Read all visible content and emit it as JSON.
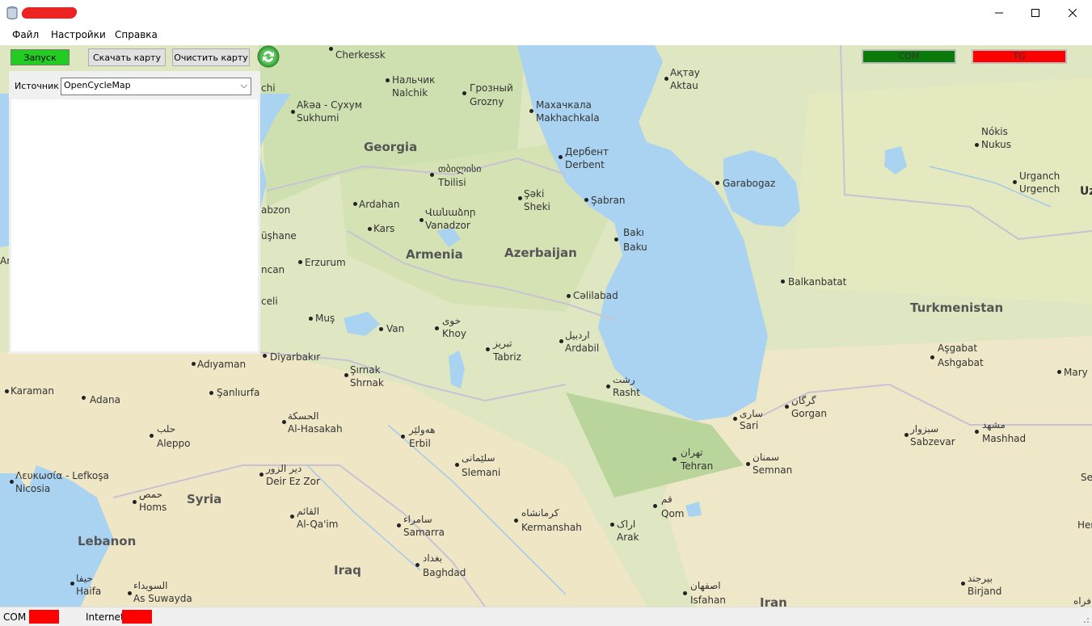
{
  "window": {
    "title_redacted": true
  },
  "menu": [
    "Файл",
    "Настройки",
    "Справка"
  ],
  "toolbar": {
    "start_label": "Запуск",
    "start_color": "#22cc22",
    "download_label": "Скачать карту",
    "clear_label": "Очистить карту",
    "refresh_icon": "refresh-icon"
  },
  "source": {
    "label": "Источник",
    "value": "OpenCycleMap"
  },
  "indicators": {
    "com": {
      "label": "COM",
      "color": "#0a7a0a"
    },
    "tg": {
      "label": "TG",
      "color": "#ff0000"
    }
  },
  "status": {
    "com_label": "COM",
    "internet_label": "Internet",
    "color": "#ff0000"
  },
  "map": {
    "countries": [
      "Georgia",
      "Armenia",
      "Azerbaijan",
      "Turkmenistan",
      "Syria",
      "Lebanon",
      "Iraq",
      "Iran"
    ],
    "cities": [
      "Cherkessk",
      "Нальчик",
      "Nalchik",
      "Грозный",
      "Grozny",
      "Махачкала",
      "Makhachkala",
      "Ақтау",
      "Aktau",
      "Аҟәа - Сухум",
      "Sukhumi",
      "chi",
      "Дербент",
      "Derbent",
      "Nókis",
      "Nukus",
      "თბილისი",
      "Tbilisi",
      "Garabogaz",
      "Urganch",
      "Urgench",
      "Şəki",
      "Sheki",
      "Şabran",
      "Ardahan",
      "Վանաձոր",
      "Vanadzor",
      "abzon",
      "Kars",
      "Bakı",
      "Baku",
      "üşhane",
      "Erzurum",
      "Balkanbatat",
      "ncan",
      "Cəlilabad",
      "celi",
      "خوی",
      "Khoy",
      "Muş",
      "Van",
      "اردبیل",
      "Ardabil",
      "تبریز",
      "Tabriz",
      "Aşgabat",
      "Ashgabat",
      "Adıyaman",
      "Diyarbakır",
      "Mary",
      "Şırnak",
      "Shrnak",
      "رشت",
      "Rasht",
      "Karaman",
      "Adana",
      "Şanlıurfa",
      "گرگان",
      "Gorgan",
      "ساری",
      "Sari",
      "الحسكة",
      "Al-Hasakah",
      "هەولێر",
      "Erbil",
      "حلب",
      "Aleppo",
      "سبزوار",
      "Sabzevar",
      "مشهد",
      "Mashhad",
      "سلێمانی",
      "Slemani",
      "تهران",
      "Tehran",
      "سمنان",
      "Semnan",
      "دير الزور",
      "Deir Ez Zor",
      "Λευκωσία - Lefkoşa",
      "Nicosia",
      "حمص",
      "Homs",
      "قم",
      "Qom",
      "القائم",
      "Al-Qa'im",
      "سامراء",
      "Samarra",
      "کرمانشاه",
      "Kermanshah",
      "اراک",
      "Arak",
      "بغداد",
      "Baghdad",
      "حيفا",
      "Haifa",
      "السويداء",
      "As Suwayda",
      "اصفهان",
      "Isfahan",
      "بیرجند",
      "Birjand",
      "Ar",
      "Se",
      "Her",
      "فراه",
      "Uz"
    ]
  }
}
